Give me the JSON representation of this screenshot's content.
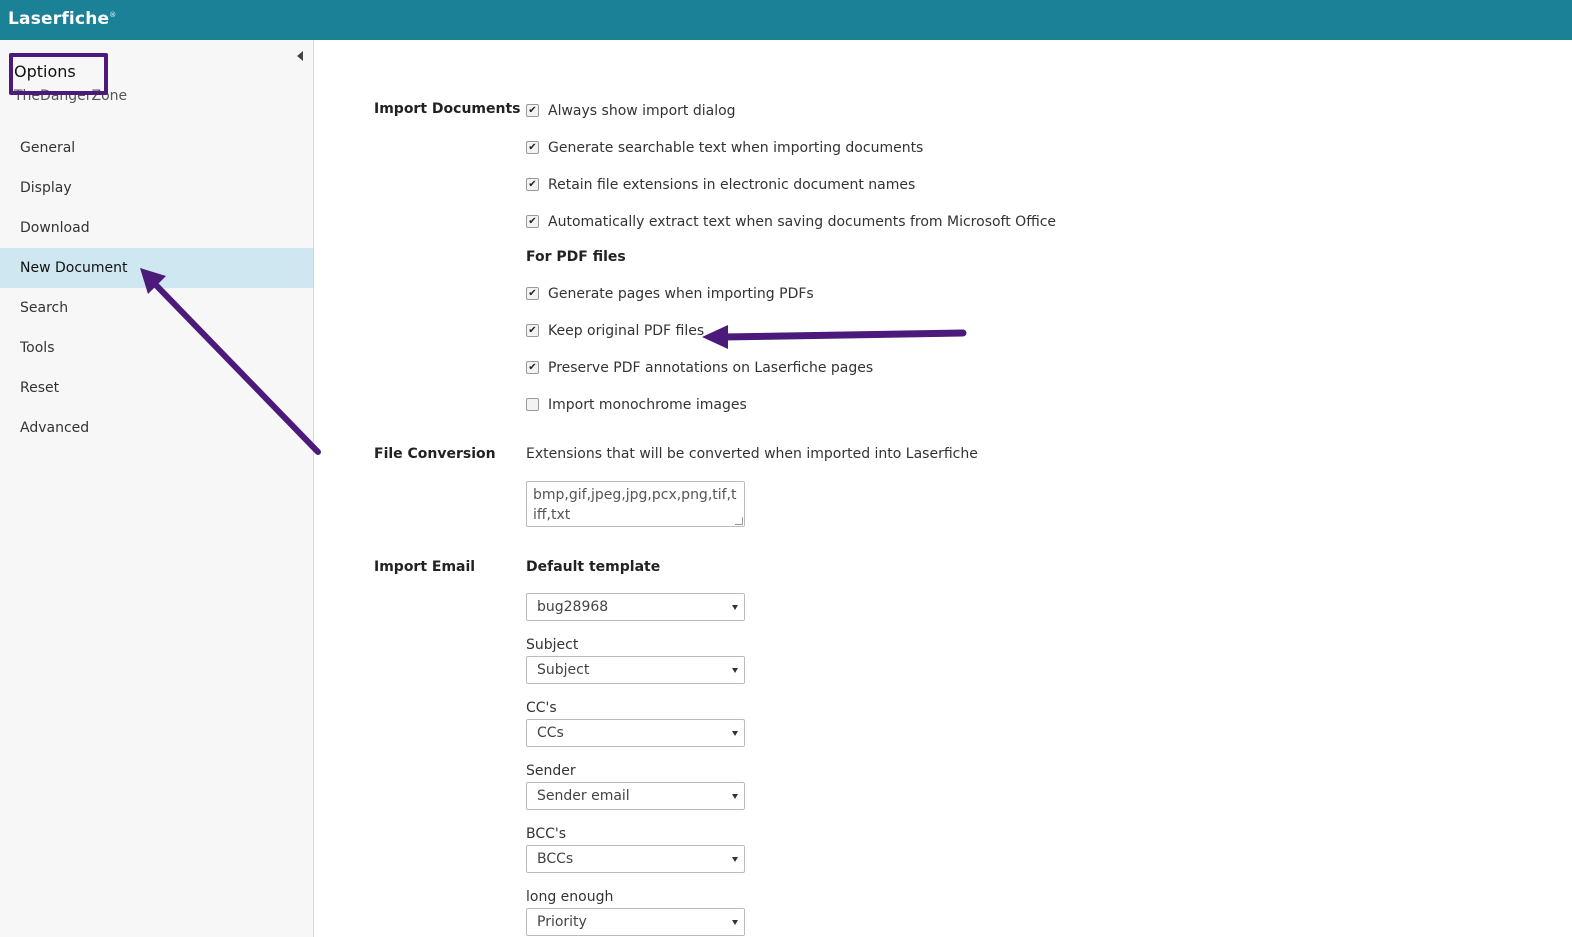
{
  "app": {
    "name": "Laserfiche",
    "trademark": "®"
  },
  "sidebar": {
    "title": "Options",
    "subtitle": "TheDangerZone",
    "items": [
      {
        "label": "General"
      },
      {
        "label": "Display"
      },
      {
        "label": "Download"
      },
      {
        "label": "New Document"
      },
      {
        "label": "Search"
      },
      {
        "label": "Tools"
      },
      {
        "label": "Reset"
      },
      {
        "label": "Advanced"
      }
    ],
    "active_index": 3
  },
  "import_documents": {
    "label": "Import Documents",
    "options": [
      {
        "label": "Always show import dialog",
        "checked": true
      },
      {
        "label": "Generate searchable text when importing documents",
        "checked": true
      },
      {
        "label": "Retain file extensions in electronic document names",
        "checked": true
      },
      {
        "label": "Automatically extract text when saving documents from Microsoft Office",
        "checked": true
      }
    ],
    "pdf_heading": "For PDF files",
    "pdf_options": [
      {
        "label": "Generate pages when importing PDFs",
        "checked": true
      },
      {
        "label": "Keep original PDF files",
        "checked": true
      },
      {
        "label": "Preserve PDF annotations on Laserfiche pages",
        "checked": true
      },
      {
        "label": "Import monochrome images",
        "checked": false
      }
    ]
  },
  "file_conversion": {
    "label": "File Conversion",
    "description": "Extensions that will be converted when imported into Laserfiche",
    "extensions": "bmp,gif,jpeg,jpg,pcx,png,tif,tiff,txt"
  },
  "import_email": {
    "label": "Import Email",
    "template_heading": "Default template",
    "template_value": "bug28968",
    "fields": [
      {
        "label": "Subject",
        "value": "Subject"
      },
      {
        "label": "CC's",
        "value": "CCs"
      },
      {
        "label": "Sender",
        "value": "Sender email"
      },
      {
        "label": "BCC's",
        "value": "BCCs"
      },
      {
        "label": "long enough",
        "value": "Priority"
      }
    ]
  },
  "colors": {
    "header": "#1a8196",
    "active_nav": "#cfe7f1",
    "annotation": "#4b1a7a"
  }
}
